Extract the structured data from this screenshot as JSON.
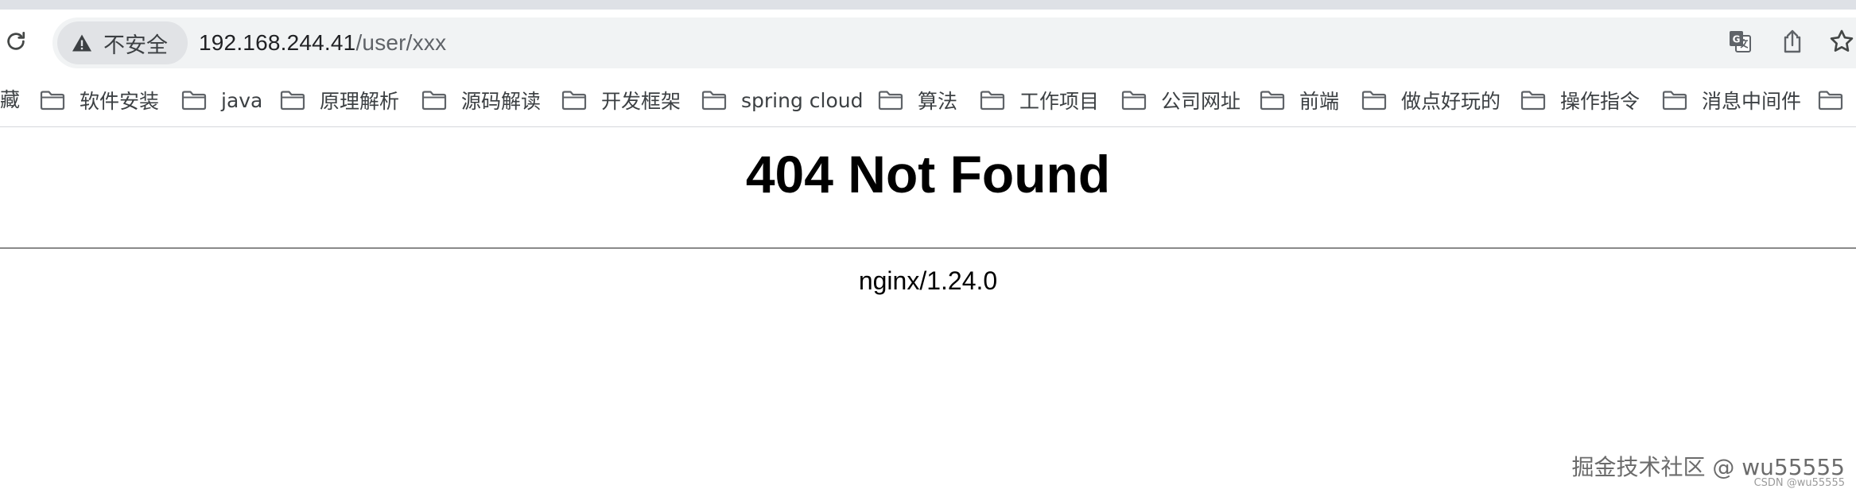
{
  "browser": {
    "security_label": "不安全",
    "url_host": "192.168.244.41",
    "url_path": "/user/xxx"
  },
  "bookmarks": {
    "clipped_label": "藏",
    "items": [
      {
        "label": "软件安装"
      },
      {
        "label": "java"
      },
      {
        "label": "原理解析"
      },
      {
        "label": "源码解读"
      },
      {
        "label": "开发框架"
      },
      {
        "label": "spring cloud"
      },
      {
        "label": "算法"
      },
      {
        "label": "工作项目"
      },
      {
        "label": "公司网址"
      },
      {
        "label": "前端"
      },
      {
        "label": "做点好玩的"
      },
      {
        "label": "操作指令"
      },
      {
        "label": "消息中间件"
      }
    ]
  },
  "page": {
    "heading": "404 Not Found",
    "server": "nginx/1.24.0"
  },
  "watermark": {
    "main": "掘金技术社区 @ wu55555",
    "sub": "CSDN @wu55555"
  },
  "icons": {
    "reload": "reload-icon",
    "warning": "warning-icon",
    "translate": "translate-icon",
    "share": "share-icon",
    "star": "star-icon",
    "folder": "folder-icon"
  }
}
